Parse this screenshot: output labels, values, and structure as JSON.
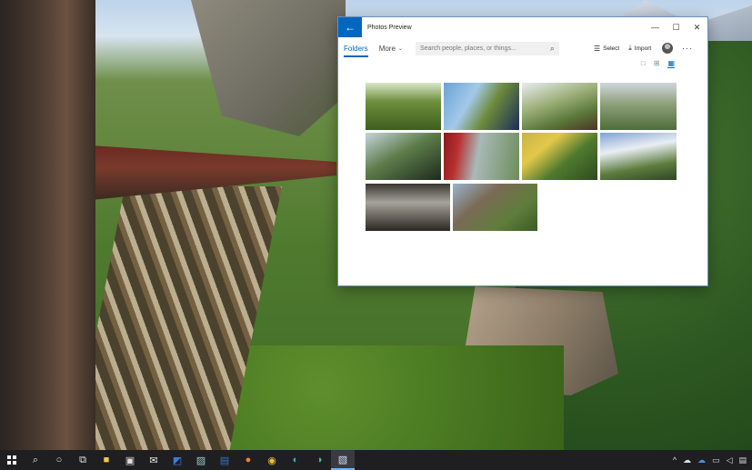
{
  "window": {
    "title": "Photos Preview",
    "back_icon": "←",
    "minimize_icon": "—",
    "maximize_icon": "☐",
    "close_icon": "✕"
  },
  "toolbar": {
    "tabs": [
      {
        "label": "Folders",
        "active": true
      },
      {
        "label": "More",
        "active": false,
        "chevron": "⌄"
      }
    ],
    "search_placeholder": "Search people, places, or things...",
    "search_icon": "⌕",
    "select_label": "Select",
    "select_icon": "☰",
    "import_label": "Import",
    "import_icon": "⤓",
    "more_icon": "···"
  },
  "view_toggles": [
    {
      "name": "large-tiles",
      "icon": "□",
      "active": false
    },
    {
      "name": "medium-tiles",
      "icon": "⊞",
      "active": false
    },
    {
      "name": "small-tiles",
      "icon": "▦",
      "active": true
    }
  ],
  "photos": [
    "meadow-forest",
    "train-window-blue-sky",
    "valley-trestle",
    "cloudy-hills",
    "train-side-forest",
    "red-train-car",
    "yellow-train",
    "mountain-view",
    "train-interior",
    "trestle-bridge"
  ],
  "taskbar": {
    "items": [
      "start",
      "search",
      "cortana",
      "task-view",
      "file-explorer",
      "store",
      "mail",
      "outlook",
      "photos-app",
      "word",
      "firefox",
      "chrome",
      "edge",
      "edge-dev",
      "photos-preview"
    ],
    "tray": {
      "chevron_icon": "^",
      "onedrive_icon": "☁",
      "network_icon": "▭",
      "volume_icon": "◁",
      "notification_icon": "▤"
    }
  }
}
